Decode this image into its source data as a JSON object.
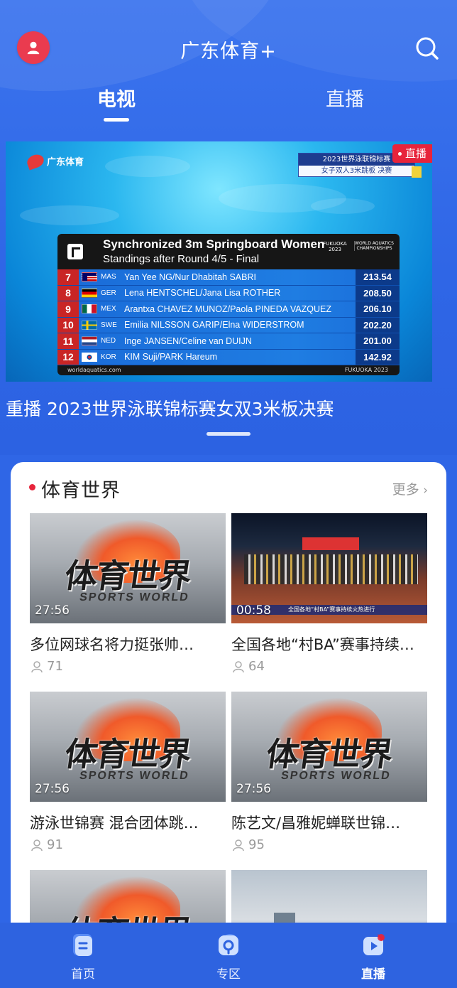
{
  "header": {
    "app_title": "广东体育+",
    "avatar_icon": "user-icon",
    "search_icon": "search-icon"
  },
  "tabs": [
    {
      "label": "电视",
      "active": true
    },
    {
      "label": "直播",
      "active": false
    }
  ],
  "hero": {
    "live_badge": "直播",
    "channel_logo": "广东体育",
    "event_title": "2023世界泳联锦标赛",
    "event_subtitle": "女子双人3米跳板 决赛",
    "standings": {
      "title": "Synchronized 3m Springboard Women",
      "subtitle": "Standings after Round 4/5 - Final",
      "sponsor_left": "FUKUOKA 2023",
      "sponsor_right": "WORLD AQUATICS CHAMPIONSHIPS",
      "footer_left": "worldaquatics.com",
      "footer_right": "FUKUOKA 2023",
      "rows": [
        {
          "rank": "7",
          "code": "MAS",
          "name": "Yan Yee NG/Nur Dhabitah SABRI",
          "score": "213.54",
          "flag": "mas"
        },
        {
          "rank": "8",
          "code": "GER",
          "name": "Lena HENTSCHEL/Jana Lisa ROTHER",
          "score": "208.50",
          "flag": "ger"
        },
        {
          "rank": "9",
          "code": "MEX",
          "name": "Arantxa CHAVEZ MUNOZ/Paola PINEDA VAZQUEZ",
          "score": "206.10",
          "flag": "mex"
        },
        {
          "rank": "10",
          "code": "SWE",
          "name": "Emilia NILSSON GARIP/Elna WIDERSTROM",
          "score": "202.20",
          "flag": "swe"
        },
        {
          "rank": "11",
          "code": "NED",
          "name": "Inge JANSEN/Celine van DUIJN",
          "score": "201.00",
          "flag": "ned"
        },
        {
          "rank": "12",
          "code": "KOR",
          "name": "KIM Suji/PARK Hareum",
          "score": "142.92",
          "flag": "kor"
        }
      ]
    },
    "caption": "重播 2023世界泳联锦标赛女双3米板决赛"
  },
  "section": {
    "title": "体育世界",
    "more_label": "更多",
    "items": [
      {
        "thumb": "sports-world",
        "duration": "27:56",
        "title": "多位网球名将力挺张帅…",
        "views": "71"
      },
      {
        "thumb": "village-ba",
        "duration": "00:58",
        "title": "全国各地“村BA”赛事持续…",
        "views": "64",
        "thumb_caption": "全国各地“村BA”赛事持续火热进行"
      },
      {
        "thumb": "sports-world",
        "duration": "27:56",
        "title": "游泳世锦赛 混合团体跳…",
        "views": "91"
      },
      {
        "thumb": "sports-world",
        "duration": "27:56",
        "title": "陈艺文/昌雅妮蝉联世锦…",
        "views": "95"
      },
      {
        "thumb": "sports-world",
        "duration": "",
        "title": "",
        "views": ""
      },
      {
        "thumb": "city",
        "duration": "",
        "title": "",
        "views": ""
      }
    ],
    "sports_world_logo_cn": "体育世界",
    "sports_world_logo_en": "SPORTS WORLD"
  },
  "bottom_nav": [
    {
      "label": "首页",
      "icon": "home-icon",
      "active": false
    },
    {
      "label": "专区",
      "icon": "zone-icon",
      "active": false
    },
    {
      "label": "直播",
      "icon": "live-icon",
      "active": true
    }
  ],
  "colors": {
    "primary": "#2f66e6",
    "accent_red": "#e7243b",
    "card_bg": "#ffffff"
  }
}
